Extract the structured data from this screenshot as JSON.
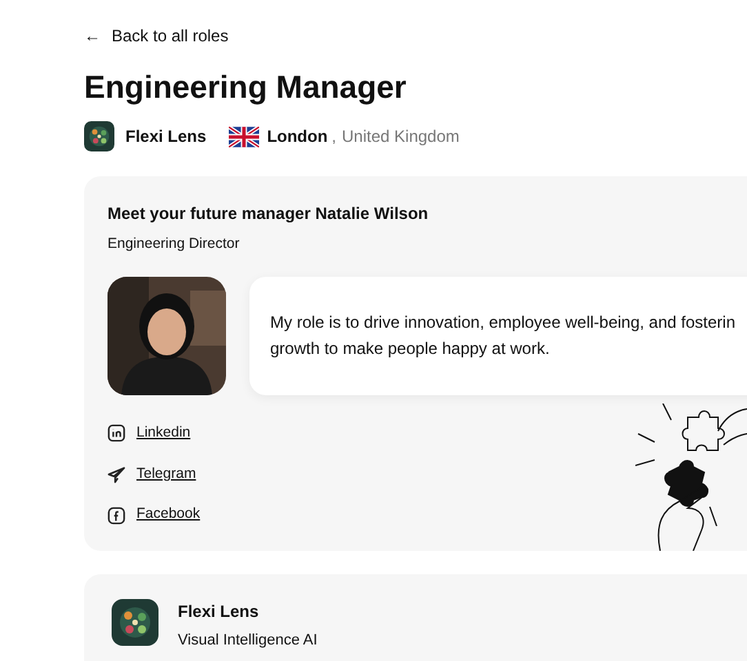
{
  "back_link": {
    "icon": "←",
    "label": "Back to all roles"
  },
  "title": "Engineering Manager",
  "company": {
    "name": "Flexi Lens",
    "city": "London",
    "separator": ",",
    "country": "United Kingdom"
  },
  "manager_card": {
    "heading": "Meet your future manager Natalie Wilson",
    "role": "Engineering Director",
    "photo": {
      "kind": "picture"
    },
    "quote_lines": [
      "My role is to drive innovation, employee well-being, and fosterin",
      "growth to make people happy at work."
    ],
    "links": [
      {
        "kind": "linkedin",
        "label": "Linkedin"
      },
      {
        "kind": "telegram",
        "label": "Telegram"
      },
      {
        "kind": "facebook",
        "label": "Facebook"
      }
    ]
  },
  "company_card": {
    "name": "Flexi Lens",
    "tagline": "Visual Intelligence AI"
  }
}
